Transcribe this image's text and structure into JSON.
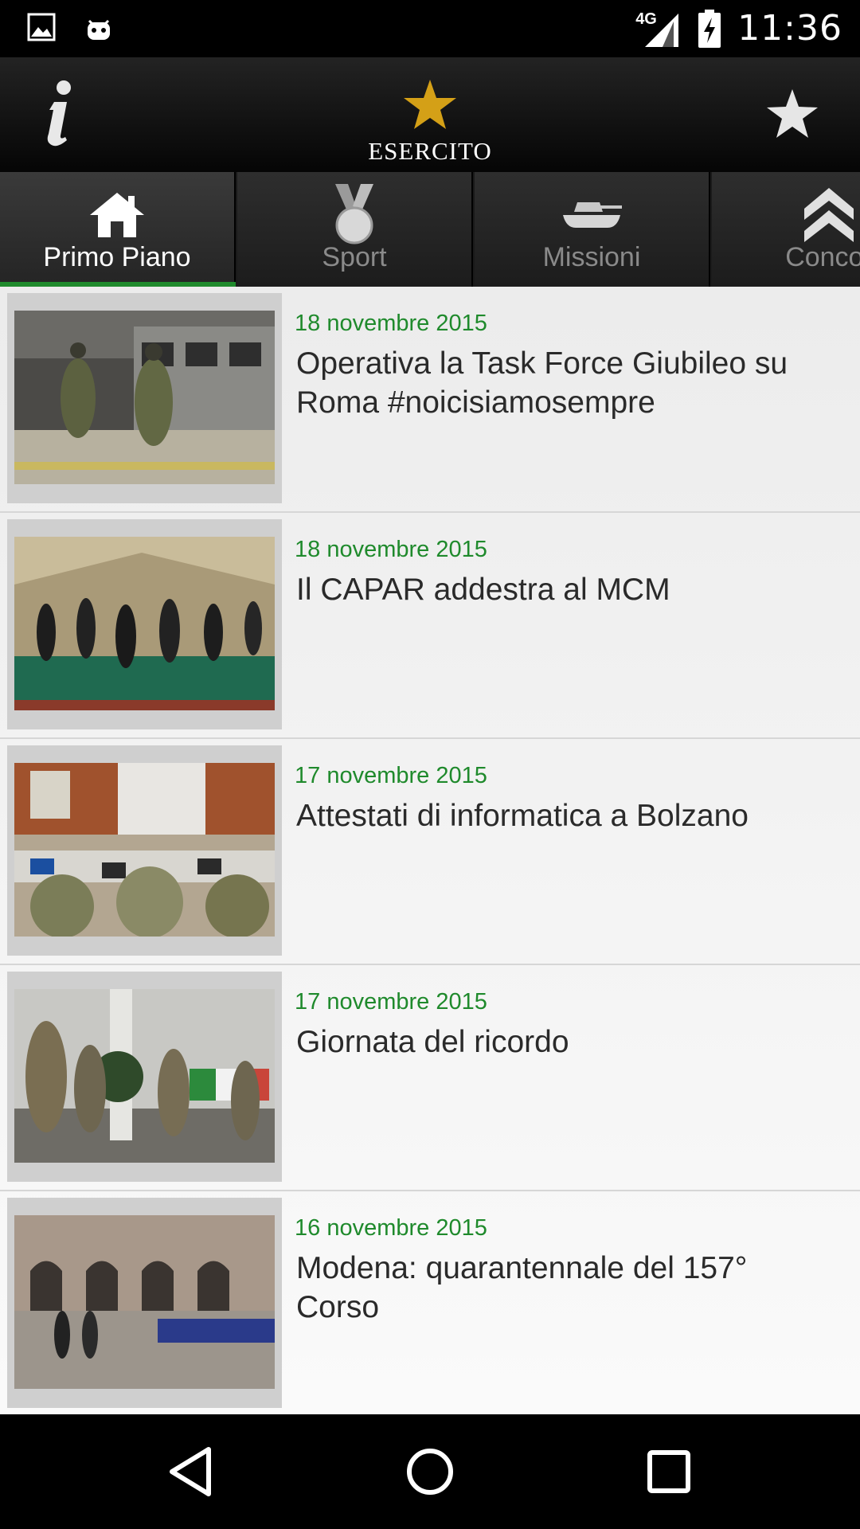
{
  "status_bar": {
    "network": "4G",
    "time": "11:36",
    "icons": [
      "image-notification-icon",
      "android-notification-icon",
      "signal-icon",
      "battery-charging-icon"
    ]
  },
  "app_bar": {
    "brand_name": "ESERCITO",
    "info_icon": "info-icon",
    "favorite_icon": "star-icon",
    "brand_color": "#d4a017"
  },
  "tabs": [
    {
      "label": "Primo Piano",
      "icon": "home-icon",
      "active": true
    },
    {
      "label": "Sport",
      "icon": "medal-icon",
      "active": false
    },
    {
      "label": "Missioni",
      "icon": "tank-icon",
      "active": false
    },
    {
      "label": "Concor",
      "icon": "rank-chevron-icon",
      "active": false
    }
  ],
  "news": [
    {
      "date": "18 novembre 2015",
      "title": "Operativa la Task Force Giubileo su Roma #noicisiamosempre"
    },
    {
      "date": "18 novembre 2015",
      "title": "Il CAPAR addestra al MCM"
    },
    {
      "date": "17 novembre 2015",
      "title": "Attestati di informatica a Bolzano"
    },
    {
      "date": "17 novembre 2015",
      "title": "Giornata del ricordo"
    },
    {
      "date": "16 novembre 2015",
      "title": "Modena: quarantennale del 157° Corso"
    }
  ],
  "colors": {
    "accent_green": "#1f8a2c",
    "title_text": "#2a2a2a",
    "inactive_tab_text": "#8a8a8a"
  },
  "nav_bar": {
    "buttons": [
      "back-icon",
      "home-circle-icon",
      "recents-icon"
    ]
  }
}
